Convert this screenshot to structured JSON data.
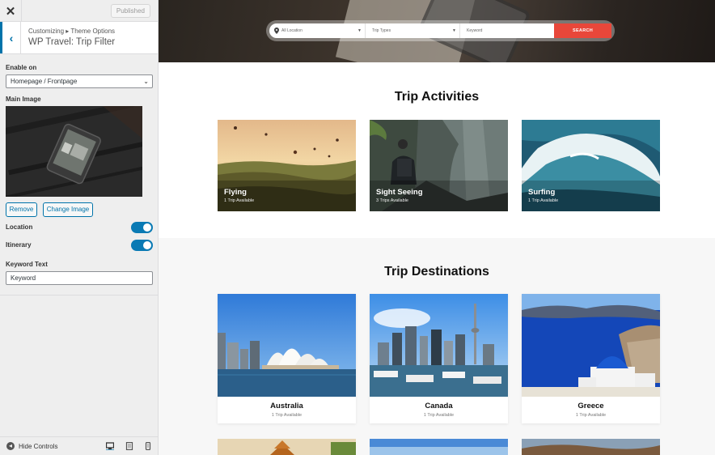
{
  "sidebar": {
    "close_icon": "close-icon",
    "published_label": "Published",
    "breadcrumb": "Customizing ▸ Theme Options",
    "section_title": "WP Travel: Trip Filter",
    "enable_on": {
      "label": "Enable on",
      "value": "Homepage / Frontpage"
    },
    "main_image": {
      "label": "Main Image",
      "remove_label": "Remove",
      "change_label": "Change Image"
    },
    "location": {
      "label": "Location",
      "enabled": true
    },
    "itinerary": {
      "label": "Itinerary",
      "enabled": true
    },
    "keyword_text": {
      "label": "Keyword Text",
      "value": "Keyword"
    },
    "footer": {
      "hide_controls_label": "Hide Controls",
      "devices": [
        "desktop-icon",
        "tablet-icon",
        "mobile-icon"
      ]
    }
  },
  "preview": {
    "search": {
      "location_placeholder": "All Location",
      "trip_types_placeholder": "Trip Types",
      "keyword_placeholder": "Keyword",
      "button_label": "SEARCH",
      "button_color": "#e8473a"
    },
    "activities": {
      "title": "Trip Activities",
      "items": [
        {
          "name": "Flying",
          "count": "1 Trip Available"
        },
        {
          "name": "Sight Seeing",
          "count": "3 Trips Available"
        },
        {
          "name": "Surfing",
          "count": "1 Trip Available"
        }
      ]
    },
    "destinations": {
      "title": "Trip Destinations",
      "items": [
        {
          "name": "Australia",
          "count": "1 Trip Available"
        },
        {
          "name": "Canada",
          "count": "1 Trip Available"
        },
        {
          "name": "Greece",
          "count": "1 Trip Available"
        }
      ]
    }
  },
  "colors": {
    "accent": "#0073aa",
    "toggle_on": "#0a7ab4"
  }
}
